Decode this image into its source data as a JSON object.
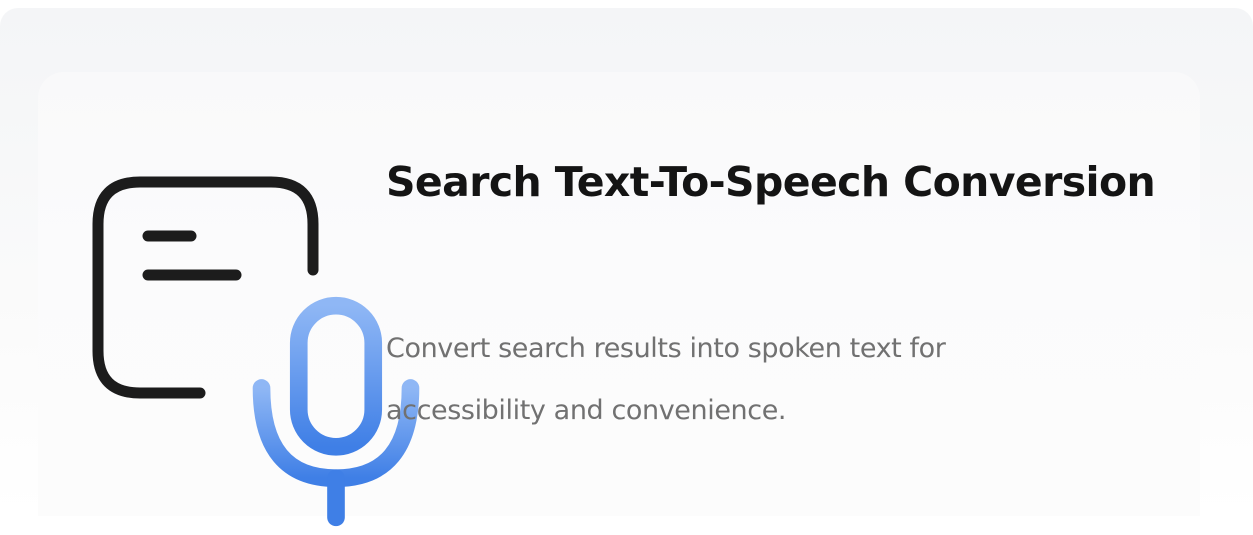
{
  "feature": {
    "title": "Search Text-To-Speech Conversion",
    "description": "Convert search results into spoken text for accessibility and convenience.",
    "icon": "document-microphone-icon"
  },
  "colors": {
    "title": "#141414",
    "description": "#717171",
    "icon_outline": "#1c1c1c",
    "mic_gradient_top": "#8fb7f5",
    "mic_gradient_bottom": "#3f7fe6",
    "card_background": "#fbfbfc"
  }
}
